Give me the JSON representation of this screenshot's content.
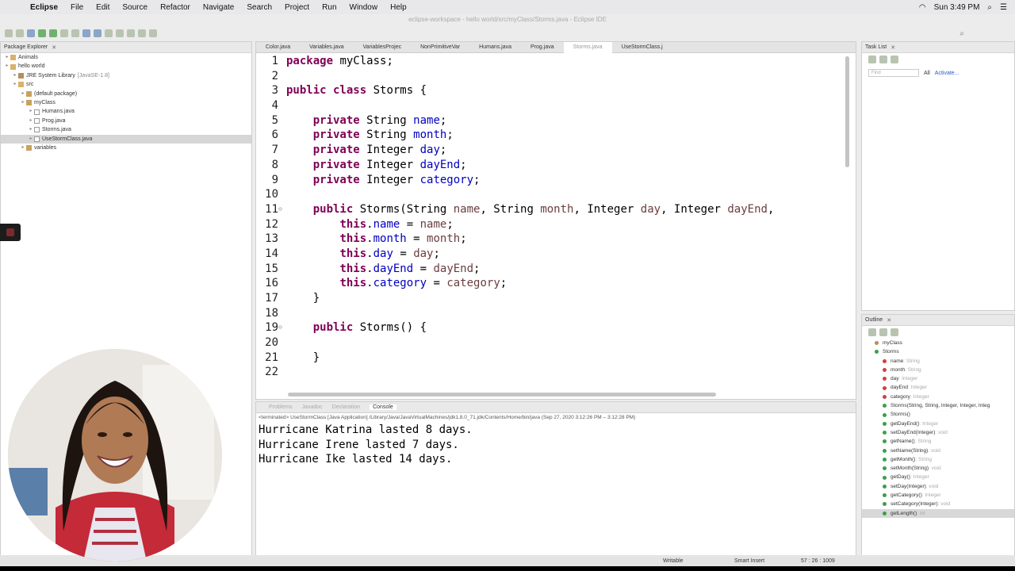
{
  "menubar": {
    "app": "Eclipse",
    "items": [
      "File",
      "Edit",
      "Source",
      "Refactor",
      "Navigate",
      "Search",
      "Project",
      "Run",
      "Window",
      "Help"
    ],
    "clock": "Sun 3:49 PM"
  },
  "window_title": "eclipse-workspace - hello world/src/myClass/Storms.java - Eclipse IDE",
  "package_explorer": {
    "title": "Package Explorer",
    "tree": [
      {
        "label": "Animals",
        "level": 0,
        "icon": "folder-icon"
      },
      {
        "label": "hello world",
        "level": 0,
        "icon": "folder-icon"
      },
      {
        "label": "JRE System Library",
        "suffix": "[JavaSE-1.8]",
        "level": 1,
        "icon": "library-icon"
      },
      {
        "label": "src",
        "level": 1,
        "icon": "folder-icon"
      },
      {
        "label": "(default package)",
        "level": 2,
        "icon": "package-icon"
      },
      {
        "label": "myClass",
        "level": 2,
        "icon": "package-icon"
      },
      {
        "label": "Humans.java",
        "level": 3,
        "icon": "java-file-icon"
      },
      {
        "label": "Prog.java",
        "level": 3,
        "icon": "java-file-icon"
      },
      {
        "label": "Storms.java",
        "level": 3,
        "icon": "java-file-icon"
      },
      {
        "label": "UseStormClass.java",
        "level": 3,
        "icon": "java-file-icon",
        "selected": true
      },
      {
        "label": "variables",
        "level": 2,
        "icon": "package-icon"
      }
    ]
  },
  "editor": {
    "tabs": [
      "Color.java",
      "Variables.java",
      "VariablesProjec",
      "NonPrimitiveVar",
      "Humans.java",
      "Prog.java",
      "Storms.java",
      "UseStormClass.j"
    ],
    "active_tab": "Storms.java",
    "lines": [
      {
        "n": "1",
        "fold": "",
        "t": [
          [
            "kw",
            "package"
          ],
          [
            "p",
            " myClass;"
          ]
        ]
      },
      {
        "n": "2",
        "fold": "",
        "t": []
      },
      {
        "n": "3",
        "fold": "",
        "t": [
          [
            "kw",
            "public class"
          ],
          [
            "p",
            " Storms {"
          ]
        ]
      },
      {
        "n": "4",
        "fold": "",
        "t": []
      },
      {
        "n": "5",
        "fold": "",
        "t": [
          [
            "p",
            "    "
          ],
          [
            "kw",
            "private"
          ],
          [
            "p",
            " String "
          ],
          [
            "f",
            "name"
          ],
          [
            "p",
            ";"
          ]
        ]
      },
      {
        "n": "6",
        "fold": "",
        "t": [
          [
            "p",
            "    "
          ],
          [
            "kw",
            "private"
          ],
          [
            "p",
            " String "
          ],
          [
            "f",
            "month"
          ],
          [
            "p",
            ";"
          ]
        ]
      },
      {
        "n": "7",
        "fold": "",
        "t": [
          [
            "p",
            "    "
          ],
          [
            "kw",
            "private"
          ],
          [
            "p",
            " Integer "
          ],
          [
            "f",
            "day"
          ],
          [
            "p",
            ";"
          ]
        ]
      },
      {
        "n": "8",
        "fold": "",
        "t": [
          [
            "p",
            "    "
          ],
          [
            "kw",
            "private"
          ],
          [
            "p",
            " Integer "
          ],
          [
            "f",
            "dayEnd"
          ],
          [
            "p",
            ";"
          ]
        ]
      },
      {
        "n": "9",
        "fold": "",
        "t": [
          [
            "p",
            "    "
          ],
          [
            "kw",
            "private"
          ],
          [
            "p",
            " Integer "
          ],
          [
            "f",
            "category"
          ],
          [
            "p",
            ";"
          ]
        ]
      },
      {
        "n": "10",
        "fold": "",
        "t": []
      },
      {
        "n": "11",
        "fold": "⊖",
        "t": [
          [
            "p",
            "    "
          ],
          [
            "kw",
            "public"
          ],
          [
            "p",
            " Storms(String "
          ],
          [
            "a",
            "name"
          ],
          [
            "p",
            ", String "
          ],
          [
            "a",
            "month"
          ],
          [
            "p",
            ", Integer "
          ],
          [
            "a",
            "day"
          ],
          [
            "p",
            ", Integer "
          ],
          [
            "a",
            "dayEnd"
          ],
          [
            "p",
            ","
          ]
        ]
      },
      {
        "n": "12",
        "fold": "",
        "t": [
          [
            "p",
            "        "
          ],
          [
            "kw",
            "this"
          ],
          [
            "p",
            "."
          ],
          [
            "f",
            "name"
          ],
          [
            "p",
            " = "
          ],
          [
            "a",
            "name"
          ],
          [
            "p",
            ";"
          ]
        ]
      },
      {
        "n": "13",
        "fold": "",
        "t": [
          [
            "p",
            "        "
          ],
          [
            "kw",
            "this"
          ],
          [
            "p",
            "."
          ],
          [
            "f",
            "month"
          ],
          [
            "p",
            " = "
          ],
          [
            "a",
            "month"
          ],
          [
            "p",
            ";"
          ]
        ]
      },
      {
        "n": "14",
        "fold": "",
        "t": [
          [
            "p",
            "        "
          ],
          [
            "kw",
            "this"
          ],
          [
            "p",
            "."
          ],
          [
            "f",
            "day"
          ],
          [
            "p",
            " = "
          ],
          [
            "a",
            "day"
          ],
          [
            "p",
            ";"
          ]
        ]
      },
      {
        "n": "15",
        "fold": "",
        "t": [
          [
            "p",
            "        "
          ],
          [
            "kw",
            "this"
          ],
          [
            "p",
            "."
          ],
          [
            "f",
            "dayEnd"
          ],
          [
            "p",
            " = "
          ],
          [
            "a",
            "dayEnd"
          ],
          [
            "p",
            ";"
          ]
        ]
      },
      {
        "n": "16",
        "fold": "",
        "t": [
          [
            "p",
            "        "
          ],
          [
            "kw",
            "this"
          ],
          [
            "p",
            "."
          ],
          [
            "f",
            "category"
          ],
          [
            "p",
            " = "
          ],
          [
            "a",
            "category"
          ],
          [
            "p",
            ";"
          ]
        ]
      },
      {
        "n": "17",
        "fold": "",
        "t": [
          [
            "p",
            "    }"
          ]
        ]
      },
      {
        "n": "18",
        "fold": "",
        "t": []
      },
      {
        "n": "19",
        "fold": "⊖",
        "t": [
          [
            "p",
            "    "
          ],
          [
            "kw",
            "public"
          ],
          [
            "p",
            " Storms() {"
          ]
        ]
      },
      {
        "n": "20",
        "fold": "",
        "t": []
      },
      {
        "n": "21",
        "fold": "",
        "t": [
          [
            "p",
            "    }"
          ]
        ]
      },
      {
        "n": "22",
        "fold": "",
        "t": []
      }
    ]
  },
  "task_list": {
    "title": "Task List",
    "find_placeholder": "Find",
    "all_label": "All",
    "activate_label": "Activate..."
  },
  "outline": {
    "title": "Outline",
    "items": [
      {
        "label": "myClass",
        "type": "",
        "kind": "package",
        "top": true
      },
      {
        "label": "Storms",
        "type": "",
        "kind": "class",
        "top": true
      },
      {
        "label": "name",
        "type": " : String",
        "kind": "field"
      },
      {
        "label": "month",
        "type": " : String",
        "kind": "field"
      },
      {
        "label": "day",
        "type": " : Integer",
        "kind": "field"
      },
      {
        "label": "dayEnd",
        "type": " : Integer",
        "kind": "field"
      },
      {
        "label": "category",
        "type": " : Integer",
        "kind": "field"
      },
      {
        "label": "Storms(String, String, Integer, Integer, Integ",
        "type": "",
        "kind": "method"
      },
      {
        "label": "Storms()",
        "type": "",
        "kind": "method"
      },
      {
        "label": "getDayEnd()",
        "type": " : Integer",
        "kind": "method"
      },
      {
        "label": "setDayEnd(Integer)",
        "type": " : void",
        "kind": "method"
      },
      {
        "label": "getName()",
        "type": " : String",
        "kind": "method"
      },
      {
        "label": "setName(String)",
        "type": " : void",
        "kind": "method"
      },
      {
        "label": "getMonth()",
        "type": " : String",
        "kind": "method"
      },
      {
        "label": "setMonth(String)",
        "type": " : void",
        "kind": "method"
      },
      {
        "label": "getDay()",
        "type": " : Integer",
        "kind": "method"
      },
      {
        "label": "setDay(Integer)",
        "type": " : void",
        "kind": "method"
      },
      {
        "label": "getCategory()",
        "type": " : Integer",
        "kind": "method"
      },
      {
        "label": "setCategory(Integer)",
        "type": " : void",
        "kind": "method"
      },
      {
        "label": "getLength()",
        "type": " : int",
        "kind": "method",
        "selected": true
      }
    ]
  },
  "console": {
    "tabs": [
      "Problems",
      "Javadoc",
      "Declaration",
      "Console"
    ],
    "active_tab": "Console",
    "terminated": "<terminated> UseStormClass [Java Application] /Library/Java/JavaVirtualMachines/jdk1.8.0_71.jdk/Contents/Home/bin/java  (Sep 27, 2020 3:12:26 PM – 3:12:28 PM)",
    "output": [
      "Hurricane Katrina lasted 8 days.",
      "Hurricane Irene lasted 7 days.",
      "Hurricane Ike lasted 14 days."
    ]
  },
  "status": {
    "writable": "Writable",
    "insert_mode": "Smart Insert",
    "position": "57 : 26 : 1009"
  },
  "colors": {
    "keyword": "#7f0055",
    "field": "#0000c0",
    "param": "#6a3e3e",
    "selection": "#d6d6d6"
  }
}
